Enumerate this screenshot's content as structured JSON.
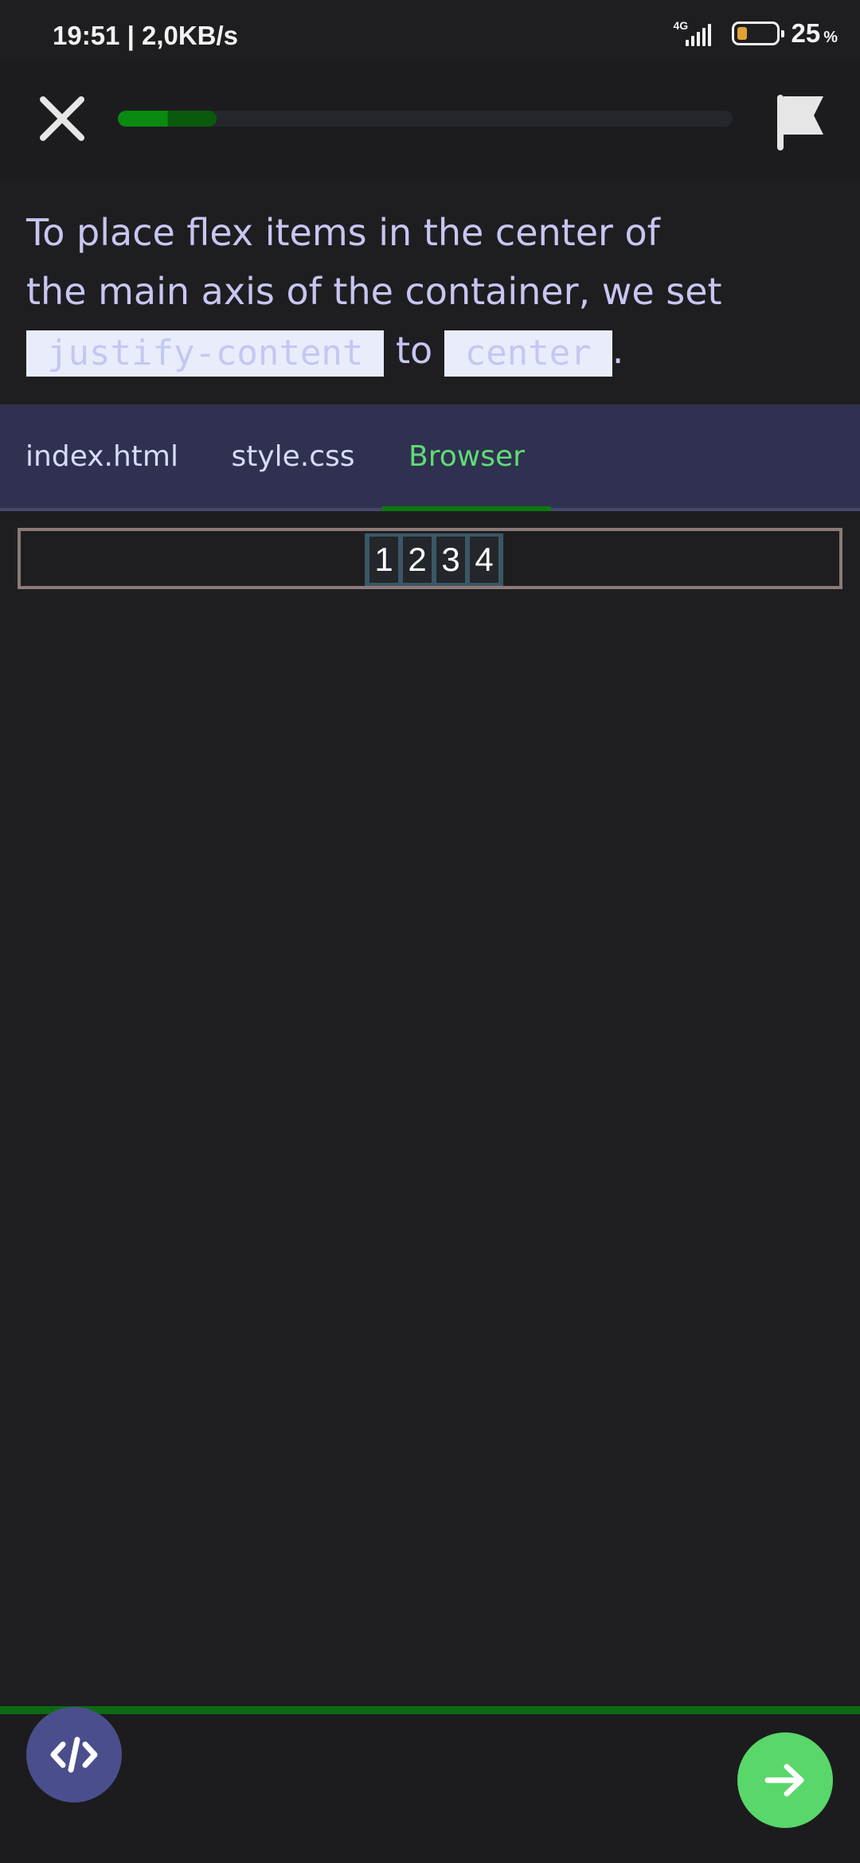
{
  "status_bar": {
    "time_speed": "19:51 | 2,0KB/s",
    "network": "4G",
    "battery_percent": "25",
    "battery_unit": "%",
    "battery_level": 0.25,
    "battery_color": "#e3a133"
  },
  "topbar": {
    "close_icon": "close-icon",
    "flag_icon": "flag-icon",
    "progress": 0.16,
    "progress_color": "#0a8a10"
  },
  "instruction": {
    "text_1": "To place flex items in the center of",
    "text_2": "the main axis of the container, we set",
    "chip_1": "justify-content",
    "text_3": " to ",
    "chip_2": "center",
    "text_4": "."
  },
  "tabs": [
    {
      "label": "index.html",
      "active": false
    },
    {
      "label": "style.css",
      "active": false
    },
    {
      "label": "Browser",
      "active": true
    }
  ],
  "preview": {
    "items": [
      "1",
      "2",
      "3",
      "4"
    ]
  },
  "bottom": {
    "code_icon": "code-icon",
    "next_icon": "arrow-right-icon",
    "accent_color": "#59d76a"
  }
}
